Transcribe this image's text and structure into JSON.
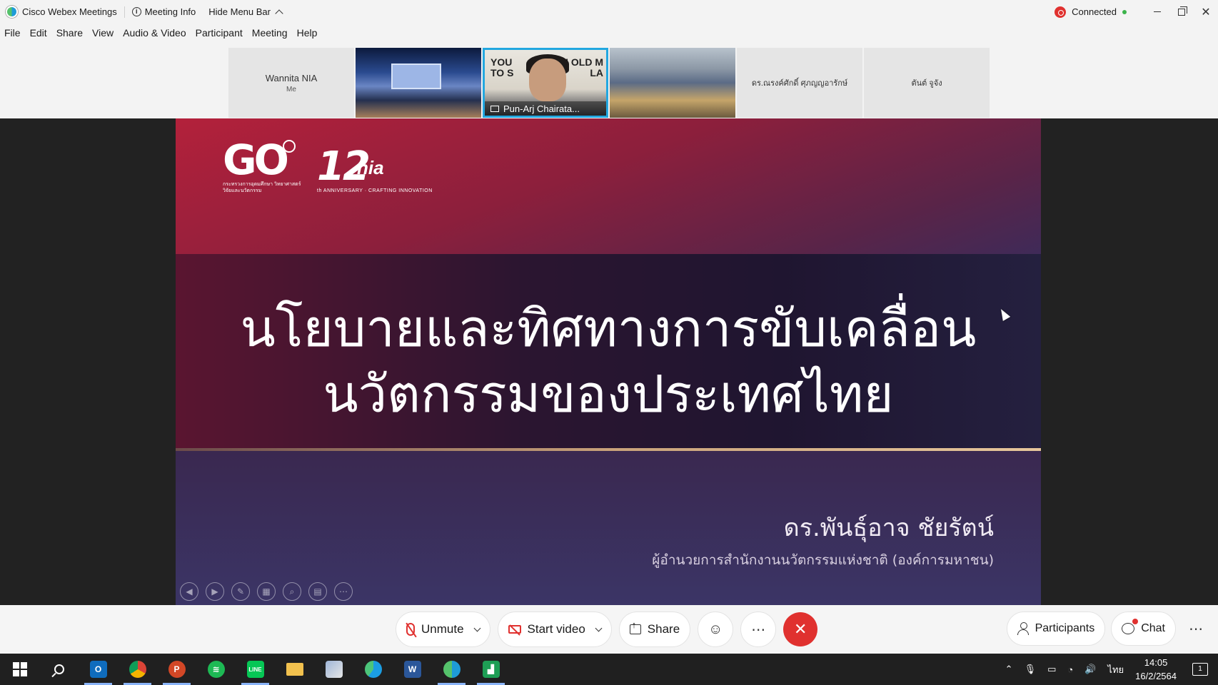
{
  "titlebar": {
    "app_name": "Cisco Webex Meetings",
    "meeting_info": "Meeting Info",
    "hide_menu": "Hide Menu Bar",
    "status": "Connected"
  },
  "menu": [
    "File",
    "Edit",
    "Share",
    "View",
    "Audio & Video",
    "Participant",
    "Meeting",
    "Help"
  ],
  "thumbnails": {
    "me_name": "Wannita NIA",
    "me_label": "Me",
    "speaker_name": "Pun-Arj Chairata...",
    "speaker_bg_left": "YOU\nTO S",
    "speaker_bg_right": "AN OLD M\nLA",
    "p4_name": "ดร.ณรงค์ศักดิ์ ศุภญญอารักษ์",
    "p5_name": "ตันต์ จูจัง"
  },
  "slide": {
    "logo_left": "GO",
    "logo_left_caption": "กระทรวงการอุดมศึกษา วิทยาศาสตร์ วิจัยและนวัตกรรม",
    "logo_right_num": "12",
    "logo_right_brand": "nia",
    "logo_right_tag": "th ANNIVERSARY · CRAFTING INNOVATION",
    "title_line1": "นโยบายและทิศทางการขับเคลื่อน",
    "title_line2": "นวัตกรรมของประเทศไทย",
    "presenter": "ดร.พันธุ์อาจ ชัยรัตน์",
    "presenter_role": "ผู้อำนวยการสำนักงานนวัตกรรมแห่งชาติ (องค์การมหาชน)"
  },
  "controls": {
    "unmute": "Unmute",
    "start_video": "Start video",
    "share": "Share",
    "participants": "Participants",
    "chat": "Chat"
  },
  "taskbar": {
    "lang": "ไทย",
    "time": "14:05",
    "date": "16/2/2564",
    "notifications": "1"
  },
  "colors": {
    "accent": "#22a7e0",
    "end_call": "#e0312f",
    "status_ok": "#3bb34a"
  }
}
